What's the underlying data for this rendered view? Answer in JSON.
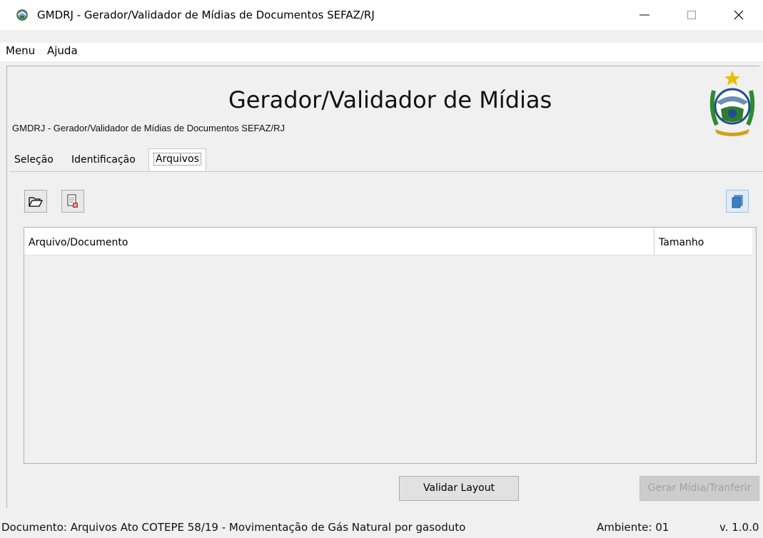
{
  "window": {
    "title": "GMDRJ - Gerador/Validador de Mídias de Documentos SEFAZ/RJ",
    "minimize_glyph": "—",
    "maximize_glyph": "☐",
    "close_glyph": "✕"
  },
  "menu": {
    "items": [
      "Menu",
      "Ajuda"
    ]
  },
  "header": {
    "title": "Gerador/Validador de Mídias",
    "subtitle": "GMDRJ - Gerador/Validador de Mídias de Documentos SEFAZ/RJ",
    "crest_icon": "rj-state-coat-of-arms-icon"
  },
  "tabs": [
    {
      "label": "Seleção",
      "selected": false
    },
    {
      "label": "Identificação",
      "selected": false
    },
    {
      "label": "Arquivos",
      "selected": true
    }
  ],
  "toolbar": {
    "open_icon": "folder-open-icon",
    "delete_icon": "delete-file-icon",
    "copy_icon": "copy-documents-icon"
  },
  "table": {
    "columns": [
      "Arquivo/Documento",
      "Tamanho"
    ],
    "rows": []
  },
  "buttons": {
    "validar": "Validar Layout",
    "gerar": "Gerar Mídia/Tranferir"
  },
  "status": {
    "documento": "Documento: Arquivos Ato COTEPE 58/19 - Movimentação de Gás Natural por gasoduto",
    "ambiente": "Ambiente: 01",
    "versao": "v. 1.0.0"
  },
  "colors": {
    "background": "#f0f0f0",
    "disabled_text": "#a0a0a0",
    "accent": "#3c7fc4"
  }
}
